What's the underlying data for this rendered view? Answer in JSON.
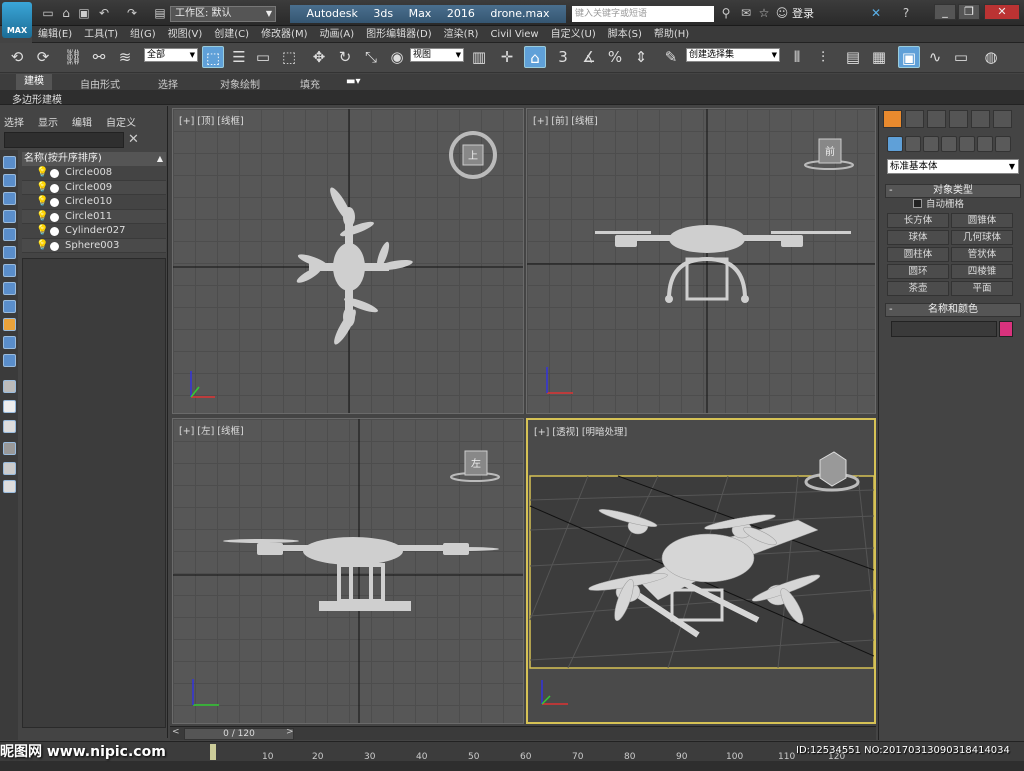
{
  "app": {
    "logo_text": "MAX",
    "workspace_label": "工作区: 默认",
    "title": "Autodesk 3ds Max 2016",
    "filename": "drone.max",
    "search_placeholder": "键入关键字或短语",
    "login": "登录"
  },
  "menu": [
    "编辑(E)",
    "工具(T)",
    "组(G)",
    "视图(V)",
    "创建(C)",
    "修改器(M)",
    "动画(A)",
    "图形编辑器(D)",
    "渲染(R)",
    "Civil View",
    "自定义(U)",
    "脚本(S)",
    "帮助(H)"
  ],
  "toolbar": {
    "filter_select": "全部",
    "coord_select": "视图",
    "snap_value": "3",
    "named_selection_set": "创建选择集"
  },
  "ribbon": {
    "tabs": [
      "建模",
      "自由形式",
      "选择",
      "对象绘制",
      "填充"
    ],
    "active_tab": "建模",
    "sub_label": "多边形建模"
  },
  "scene_explorer": {
    "menu": [
      "选择",
      "显示",
      "编辑",
      "自定义"
    ],
    "header": "名称(按升序排序)",
    "items": [
      "Circle008",
      "Circle009",
      "Circle010",
      "Circle011",
      "Cylinder027",
      "Sphere003"
    ]
  },
  "viewports": {
    "top": "[+] [顶] [线框]",
    "front": "[+] [前] [线框]",
    "left": "[+] [左] [线框]",
    "perspective": "[+] [透视] [明暗处理]",
    "viewcube_top": "上",
    "viewcube_front": "前",
    "viewcube_left": "左"
  },
  "command_panel": {
    "dropdown": "标准基本体",
    "rollout_object_type": "对象类型",
    "auto_grid": "自动栅格",
    "object_buttons": [
      "长方体",
      "圆锥体",
      "球体",
      "几何球体",
      "圆柱体",
      "管状体",
      "圆环",
      "四棱锥",
      "茶壶",
      "平面"
    ],
    "rollout_name_color": "名称和颜色",
    "color_hex": "#d9327d"
  },
  "timeline": {
    "frame_display": "0 / 120",
    "ticks": [
      "10",
      "20",
      "30",
      "40",
      "50",
      "60",
      "70",
      "80",
      "90",
      "100",
      "110",
      "120"
    ]
  },
  "overlay": {
    "watermark": "昵图网 www.nipic.com",
    "image_id": "ID:12534551 NO:20170313090318414034"
  }
}
